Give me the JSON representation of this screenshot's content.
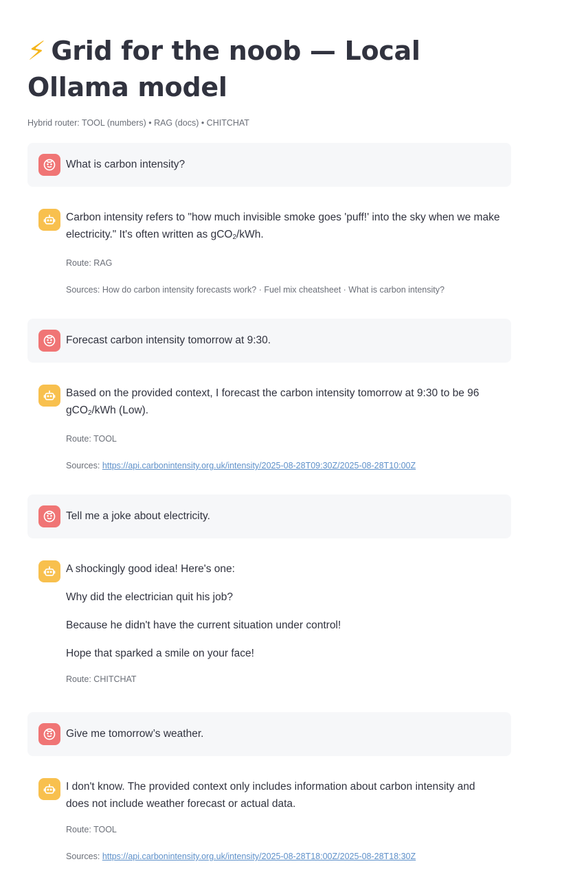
{
  "header": {
    "bolt_glyph": "⚡",
    "title": "Grid for the noob — Local Ollama model",
    "subtitle": "Hybrid router: TOOL (numbers) • RAG (docs) • CHITCHAT"
  },
  "colors": {
    "user_avatar": "#f07575",
    "bot_avatar": "#f8c04e",
    "user_bubble": "#f6f7f9",
    "link": "#5e90c9"
  },
  "messages": [
    {
      "role": "user",
      "avatar_icon": "user-face-icon",
      "text": "What is carbon intensity?"
    },
    {
      "role": "assistant",
      "avatar_icon": "robot-icon",
      "text_pre": "Carbon intensity refers to \"how much invisible smoke goes 'puff!' into the sky when we make electricity.\" It's often written as gCO",
      "text_sub": "2",
      "text_post": "/kWh.",
      "route": "Route: RAG",
      "sources_label": "Sources: ",
      "sources_text": "How do carbon intensity forecasts work? · Fuel mix cheatsheet · What is carbon intensity?"
    },
    {
      "role": "user",
      "avatar_icon": "user-face-icon",
      "text": "Forecast carbon intensity tomorrow at 9:30."
    },
    {
      "role": "assistant",
      "avatar_icon": "robot-icon",
      "text_pre": "Based on the provided context, I forecast the carbon intensity tomorrow at 9:30 to be 96 gCO",
      "text_sub": "2",
      "text_post": "/kWh (Low).",
      "route": "Route: TOOL",
      "sources_label": "Sources: ",
      "sources_link": "https://api.carbonintensity.org.uk/intensity/2025-08-28T09:30Z/2025-08-28T10:00Z"
    },
    {
      "role": "user",
      "avatar_icon": "user-face-icon",
      "text": "Tell me a joke about electricity."
    },
    {
      "role": "assistant",
      "avatar_icon": "robot-icon",
      "paragraphs": [
        "A shockingly good idea! Here's one:",
        "Why did the electrician quit his job?",
        "Because he didn't have the current situation under control!",
        "Hope that sparked a smile on your face!"
      ],
      "route": "Route: CHITCHAT"
    },
    {
      "role": "user",
      "avatar_icon": "user-face-icon",
      "text": "Give me tomorrow’s weather."
    },
    {
      "role": "assistant",
      "avatar_icon": "robot-icon",
      "text": "I don't know. The provided context only includes information about carbon intensity and does not include weather forecast or actual data.",
      "route": "Route: TOOL",
      "sources_label": "Sources: ",
      "sources_link": "https://api.carbonintensity.org.uk/intensity/2025-08-28T18:00Z/2025-08-28T18:30Z"
    }
  ]
}
